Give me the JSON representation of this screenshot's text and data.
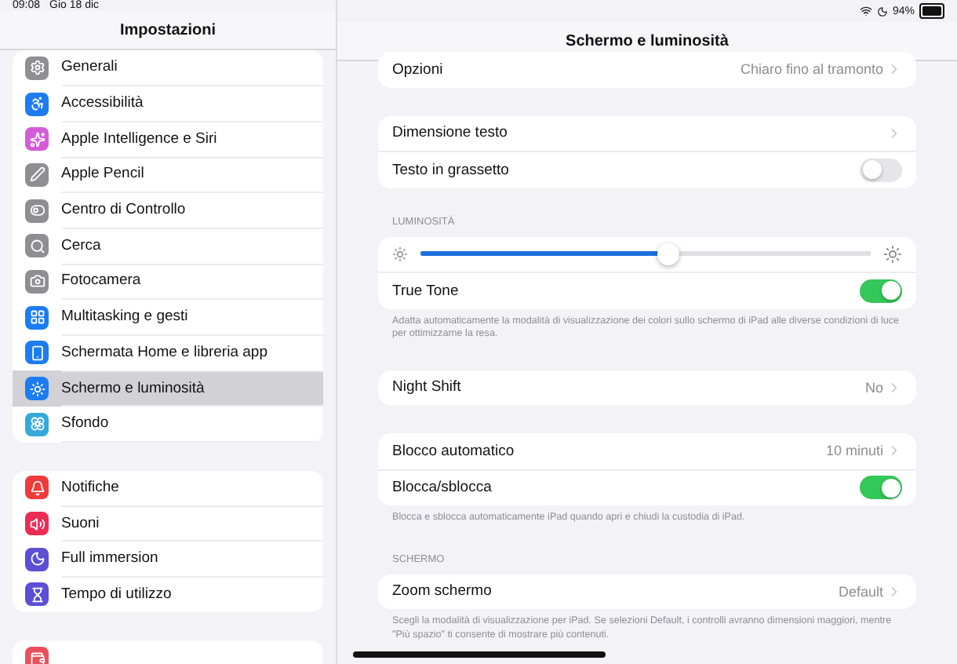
{
  "status_bar": {
    "time": "09:08",
    "date": "Gio 18 dic",
    "battery": "94%"
  },
  "sidebar": {
    "title": "Impostazioni",
    "groups": [
      {
        "items": [
          {
            "label": "Generali",
            "color": "#8e8e93",
            "selected": false
          },
          {
            "label": "Accessibilità",
            "color": "#1c7cf2",
            "selected": false
          },
          {
            "label": "Apple Intelligence e Siri",
            "color": "#d65bd8",
            "selected": false
          },
          {
            "label": "Apple Pencil",
            "color": "#8e8e93",
            "selected": false
          },
          {
            "label": "Centro di Controllo",
            "color": "#8e8e93",
            "selected": false
          },
          {
            "label": "Cerca",
            "color": "#8e8e93",
            "selected": false
          },
          {
            "label": "Fotocamera",
            "color": "#8e8e93",
            "selected": false
          },
          {
            "label": "Multitasking e gesti",
            "color": "#1c7cf2",
            "selected": false
          },
          {
            "label": "Schermata Home e libreria app",
            "color": "#1c7cf2",
            "selected": false
          },
          {
            "label": "Schermo e luminosità",
            "color": "#1c7cf2",
            "selected": true
          },
          {
            "label": "Sfondo",
            "color": "#34aadc",
            "selected": false
          }
        ]
      },
      {
        "items": [
          {
            "label": "Notifiche",
            "color": "#ef3b3b",
            "selected": false
          },
          {
            "label": "Suoni",
            "color": "#ec2c55",
            "selected": false
          },
          {
            "label": "Full immersion",
            "color": "#5b4fd6",
            "selected": false
          },
          {
            "label": "Tempo di utilizzo",
            "color": "#5b4fd6",
            "selected": false
          }
        ]
      },
      {
        "items": [
          {
            "color": "#e8505b",
            "selected": false
          }
        ]
      }
    ]
  },
  "detail": {
    "title": "Schermo e luminosità",
    "sections": [
      {
        "rows": [
          {
            "kind": "link",
            "label": "Opzioni",
            "value": "Chiaro fino al tramonto"
          }
        ]
      },
      {
        "rows": [
          {
            "kind": "link",
            "label": "Dimensione testo"
          },
          {
            "kind": "toggle",
            "label": "Testo in grassetto",
            "on": false
          }
        ]
      },
      {
        "header": "LUMINOSITÀ",
        "rows": [
          {
            "kind": "slider",
            "level": 0.55
          },
          {
            "kind": "toggle",
            "label": "True Tone",
            "on": true
          }
        ],
        "footer": "Adatta automaticamente la modalità di visualizzazione dei colori sullo schermo di iPad alle diverse condizioni di luce per ottimizzarne la resa."
      },
      {
        "rows": [
          {
            "kind": "link",
            "label": "Night Shift",
            "value": "No"
          }
        ]
      },
      {
        "rows": [
          {
            "kind": "link",
            "label": "Blocco automatico",
            "value": "10 minuti"
          },
          {
            "kind": "toggle",
            "label": "Blocca/sblocca",
            "on": true
          }
        ],
        "footer": "Blocca e sblocca automaticamente iPad quando apri e chiudi la custodia di iPad."
      },
      {
        "header": "SCHERMO",
        "rows": [
          {
            "kind": "link",
            "label": "Zoom schermo",
            "value": "Default"
          }
        ],
        "footer": "Scegli la modalità di visualizzazione per iPad. Se selezioni Default, i controlli avranno dimensioni maggiori, mentre \"Più spazio\" ti consente di mostrare più contenuti."
      }
    ]
  }
}
